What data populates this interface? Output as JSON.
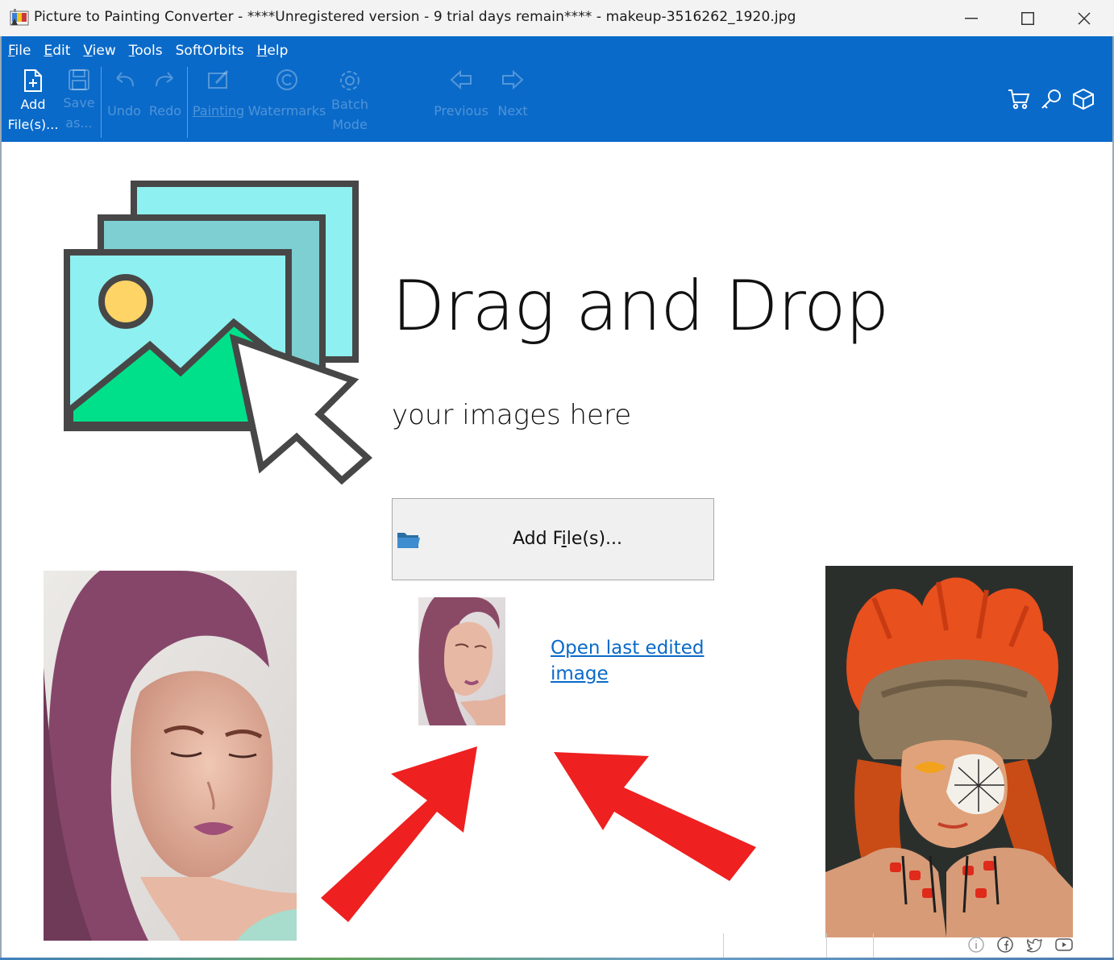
{
  "window": {
    "title": "Picture to Painting Converter - ****Unregistered version - 9 trial days remain**** - makeup-3516262_1920.jpg"
  },
  "menu": {
    "items": [
      {
        "key": "F",
        "rest": "ile"
      },
      {
        "key": "E",
        "rest": "dit"
      },
      {
        "key": "V",
        "rest": "iew"
      },
      {
        "key": "T",
        "rest": "ools"
      },
      {
        "key": "",
        "rest": "SoftOrbits"
      },
      {
        "key": "H",
        "rest": "elp"
      }
    ]
  },
  "toolbar": {
    "add_files": {
      "line1": "Add",
      "line2": "File(s)..."
    },
    "save_as": {
      "line1": "Save",
      "line2": "as..."
    },
    "undo": "Undo",
    "redo": "Redo",
    "painting": "Painting",
    "watermarks": "Watermarks",
    "batch_mode": {
      "line1": "Batch",
      "line2": "Mode"
    },
    "previous": "Previous",
    "next": "Next"
  },
  "main": {
    "title": "Drag and Drop",
    "subtitle": "your images here",
    "add_button": {
      "before": "Add F",
      "underlined": "i",
      "after": "le(s)..."
    },
    "open_last": {
      "line1": "Open last edited",
      "line2": "image"
    }
  },
  "colors": {
    "ribbon": "#0a6ac9",
    "link": "#0a6ac9",
    "arrow_red": "#ee2020"
  },
  "icons": {
    "right": [
      "cart-icon",
      "key-icon",
      "box-icon"
    ],
    "social": [
      "info-icon",
      "facebook-icon",
      "twitter-icon",
      "youtube-icon"
    ]
  }
}
